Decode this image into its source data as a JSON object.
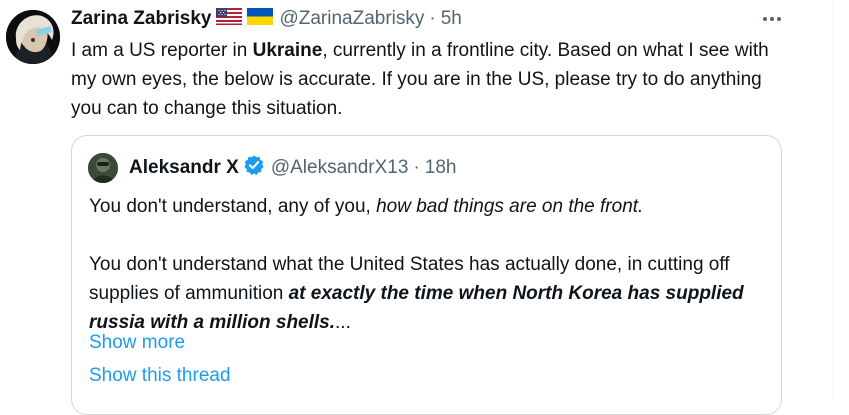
{
  "tweet": {
    "author_name": "Zarina Zabrisky",
    "flags": [
      "us-flag-icon",
      "ukraine-flag-icon"
    ],
    "handle": "@ZarinaZabrisky",
    "separator": "·",
    "time": "5h",
    "text_1": "I am a US reporter in ",
    "text_bold": "Ukraine",
    "text_2": ", currently in a frontline city.  Based on what I see with my own eyes, the below is accurate. If you are in the US, please try to do anything you can to change this situation."
  },
  "quote": {
    "author_name": "Aleksandr X",
    "verified": true,
    "handle": "@AleksandrX13",
    "separator": "·",
    "time": "18h",
    "para1_plain": "You don't understand, any of you, ",
    "para1_italic": "how bad things are on the front.",
    "para2_plain": "You don't understand what the United States has actually done, in cutting off supplies of ammunition ",
    "para2_bold_italic": "at exactly the time when North Korea has supplied russia with a million shells.",
    "para2_ellipsis": "...",
    "show_more": "Show more",
    "show_thread": "Show this thread"
  },
  "colors": {
    "link": "#1d9bf0",
    "secondary": "#536471",
    "verified": "#1d9bf0",
    "border": "#cfd9de"
  }
}
